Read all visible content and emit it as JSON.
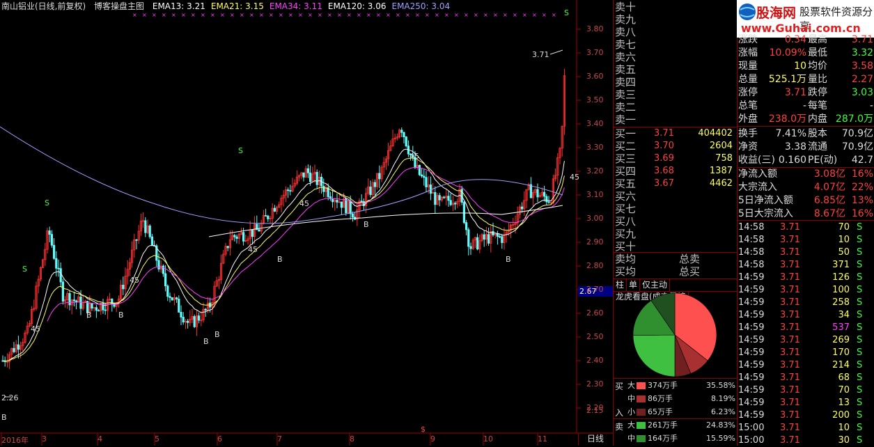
{
  "title_bar": {
    "stock": "南山铝业(日线,前复权)",
    "indicator": "博客操盘主图",
    "ema": [
      {
        "label": "EMA13: 3.21",
        "color": "#ffffff"
      },
      {
        "label": "EMA21: 3.15",
        "color": "#ffff60"
      },
      {
        "label": "EMA34: 3.11",
        "color": "#ff40ff"
      },
      {
        "label": "EMA120: 3.06",
        "color": "#ffffff"
      },
      {
        "label": "EMA250: 3.04",
        "color": "#a0a0ff"
      }
    ]
  },
  "chart_data": {
    "type": "candlestick",
    "y_axis_labels": [
      "3.80",
      "3.70",
      "3.60",
      "3.50",
      "3.40",
      "3.30",
      "3.20",
      "3.10",
      "3.00",
      "2.90",
      "2.80",
      "2.70",
      "2.60",
      "2.50",
      "2.40",
      "2.30",
      "2.20",
      "2.15"
    ],
    "ylim": [
      2.15,
      3.8
    ],
    "x_axis_labels": [
      "2016年",
      "3",
      "4",
      "5",
      "6",
      "7",
      "8",
      "9",
      "10",
      "11"
    ],
    "current_price_label": "2.67",
    "period_label": "日线",
    "annotations": {
      "high_label": "3.71",
      "low_label": "2.26",
      "ema_tag": "45",
      "buy": "B",
      "sell": "S",
      "dollar": "$"
    },
    "colors": {
      "up": "#ff3030",
      "down": "#60ffff",
      "ema13": "#ffffff",
      "ema21": "#ffff60",
      "ema34": "#ff40ff",
      "ema120": "#ffffff",
      "ema250": "#a0a0ff"
    }
  },
  "order_book": {
    "sell_levels": [
      "卖十",
      "卖九",
      "卖八",
      "卖七",
      "卖六",
      "卖五",
      "卖四",
      "卖三",
      "卖二",
      "卖一"
    ],
    "buy_levels": [
      {
        "label": "买一",
        "price": "3.71",
        "vol": "404402"
      },
      {
        "label": "买二",
        "price": "3.70",
        "vol": "2604"
      },
      {
        "label": "买三",
        "price": "3.69",
        "vol": "758"
      },
      {
        "label": "买四",
        "price": "3.68",
        "vol": "1387"
      },
      {
        "label": "买五",
        "price": "3.67",
        "vol": "4462"
      },
      {
        "label": "买六",
        "price": "",
        "vol": ""
      },
      {
        "label": "买七",
        "price": "",
        "vol": ""
      },
      {
        "label": "买八",
        "price": "",
        "vol": ""
      },
      {
        "label": "买九",
        "price": "",
        "vol": ""
      },
      {
        "label": "买十",
        "price": "",
        "vol": ""
      }
    ],
    "avg_sell_label": "卖均",
    "avg_buy_label": "买均",
    "total_sell_label": "总卖",
    "total_buy_label": "总买"
  },
  "tabs": [
    "柱",
    "单",
    "仅主动",
    "龙虎看盘(成交量榜"
  ],
  "fund_flow": {
    "buy_side": [
      "买",
      "入"
    ],
    "sell_side": "卖",
    "rows": [
      {
        "size": "大",
        "amount": "374万手",
        "pct": "35.58%",
        "color": "#ff5050",
        "fraction": 0.3558
      },
      {
        "size": "中",
        "amount": "86万手",
        "pct": "8.19%",
        "color": "#a83030",
        "fraction": 0.0819
      },
      {
        "size": "小",
        "amount": "65万手",
        "pct": "6.23%",
        "color": "#702020",
        "fraction": 0.0623
      },
      {
        "size": "大",
        "amount": "261万手",
        "pct": "24.83%",
        "color": "#40c040",
        "fraction": 0.2483
      },
      {
        "size": "中",
        "amount": "164万手",
        "pct": "15.59%",
        "color": "#309030",
        "fraction": 0.1559
      }
    ],
    "pie_extra": [
      {
        "color": "#205020",
        "fraction": 0.0958
      }
    ]
  },
  "logo": {
    "brand": "股海网",
    "slogan": "股票软件资源分享",
    "url": "www.Guhai.com.cn"
  },
  "quote": [
    {
      "l1": "涨跌",
      "v1": "0.34",
      "c1": "#ff4040",
      "l2": "最高",
      "v2": "3.71",
      "c2": "#ff4040"
    },
    {
      "l1": "涨幅",
      "v1": "10.09%",
      "c1": "#ff4040",
      "l2": "最低",
      "v2": "3.32",
      "c2": "#40ff40"
    },
    {
      "l1": "现量",
      "v1": "10",
      "c1": "#ffff60",
      "l2": "均价",
      "v2": "3.58",
      "c2": "#ff4040"
    },
    {
      "l1": "总量",
      "v1": "525.1万",
      "c1": "#ffff60",
      "l2": "量比",
      "v2": "2.27",
      "c2": "#ff4040"
    },
    {
      "l1": "涨停",
      "v1": "3.71",
      "c1": "#ff4040",
      "l2": "跌停",
      "v2": "3.03",
      "c2": "#40ff40"
    },
    {
      "l1": "总笔",
      "v1": "-",
      "c1": "#dddddd",
      "l2": "每笔",
      "v2": "-",
      "c2": "#dddddd"
    },
    {
      "l1": "外盘",
      "v1": "238.0万",
      "c1": "#ff4040",
      "l2": "内盘",
      "v2": "287.0万",
      "c2": "#40ff40"
    },
    {
      "l1": "换手",
      "v1": "7.41%",
      "c1": "#dddddd",
      "l2": "股本",
      "v2": "70.9亿",
      "c2": "#dddddd"
    },
    {
      "l1": "净资",
      "v1": "3.38",
      "c1": "#dddddd",
      "l2": "流通",
      "v2": "70.9亿",
      "c2": "#dddddd"
    },
    {
      "l1": "收益(三)",
      "v1": "0.160",
      "c1": "#dddddd",
      "l2": "PE(动)",
      "v2": "42.7",
      "c2": "#dddddd"
    }
  ],
  "flows": [
    {
      "label": "净流入额",
      "value": "3.08亿",
      "pct": "16%"
    },
    {
      "label": "大宗流入",
      "value": "4.07亿",
      "pct": "22%"
    },
    {
      "label": "5日净流入额",
      "value": "6.85亿",
      "pct": "13%"
    },
    {
      "label": "5日大宗流入",
      "value": "8.67亿",
      "pct": "16%"
    }
  ],
  "ticks": [
    {
      "time": "14:58",
      "price": "3.71",
      "vol": "70",
      "side": "S",
      "vc": "#ffff60"
    },
    {
      "time": "14:58",
      "price": "3.71",
      "vol": "10",
      "side": "S",
      "vc": "#ffff60"
    },
    {
      "time": "14:58",
      "price": "3.71",
      "vol": "50",
      "side": "S",
      "vc": "#ffff60"
    },
    {
      "time": "14:58",
      "price": "3.71",
      "vol": "371",
      "side": "S",
      "vc": "#ffff60"
    },
    {
      "time": "14:59",
      "price": "3.71",
      "vol": "126",
      "side": "S",
      "vc": "#ffff60"
    },
    {
      "time": "14:59",
      "price": "3.71",
      "vol": "100",
      "side": "S",
      "vc": "#ffff60"
    },
    {
      "time": "14:59",
      "price": "3.71",
      "vol": "258",
      "side": "S",
      "vc": "#ffff60"
    },
    {
      "time": "14:59",
      "price": "3.71",
      "vol": "34",
      "side": "S",
      "vc": "#ffff60"
    },
    {
      "time": "14:59",
      "price": "3.71",
      "vol": "537",
      "side": "S",
      "vc": "#ff40ff"
    },
    {
      "time": "14:59",
      "price": "3.71",
      "vol": "269",
      "side": "S",
      "vc": "#ffff60"
    },
    {
      "time": "14:59",
      "price": "3.71",
      "vol": "170",
      "side": "S",
      "vc": "#ffff60"
    },
    {
      "time": "14:59",
      "price": "3.71",
      "vol": "214",
      "side": "S",
      "vc": "#ffff60"
    },
    {
      "time": "14:59",
      "price": "3.71",
      "vol": "68",
      "side": "S",
      "vc": "#ffff60"
    },
    {
      "time": "14:59",
      "price": "3.71",
      "vol": "70",
      "side": "S",
      "vc": "#ffff60"
    },
    {
      "time": "14:59",
      "price": "3.71",
      "vol": "13",
      "side": "S",
      "vc": "#ffff60"
    },
    {
      "time": "14:59",
      "price": "3.71",
      "vol": "200",
      "side": "S",
      "vc": "#ffff60"
    },
    {
      "time": "15:00",
      "price": "3.71",
      "vol": "10",
      "side": "S",
      "vc": "#ffff60"
    },
    {
      "time": "15:00",
      "price": "3.71",
      "vol": "30",
      "side": "S",
      "vc": "#ffff60"
    }
  ]
}
